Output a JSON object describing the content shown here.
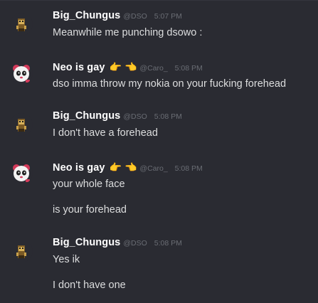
{
  "users": {
    "big": {
      "name": "Big_Chungus",
      "handle": "@DSO"
    },
    "neo": {
      "name": "Neo is gay",
      "handle": "@Caro_",
      "emojis": [
        "👉",
        "👈"
      ]
    }
  },
  "groups": [
    {
      "user": "big",
      "time": "5:07 PM",
      "messages": [
        "Meanwhile me punching dsowo :"
      ]
    },
    {
      "user": "neo",
      "time": "5:08 PM",
      "messages": [
        "dso imma throw my nokia on your fucking forehead"
      ]
    },
    {
      "user": "big",
      "time": "5:08 PM",
      "messages": [
        "I don't have a forehead"
      ]
    },
    {
      "user": "neo",
      "time": "5:08 PM",
      "messages": [
        "your whole face",
        "is your forehead"
      ]
    },
    {
      "user": "big",
      "time": "5:08 PM",
      "messages": [
        "Yes ik",
        "I don't have one"
      ]
    }
  ],
  "colors": {
    "background": "#2a2b32",
    "username": "#ffffff",
    "message": "#dcddde",
    "meta": "#6a6d74"
  }
}
